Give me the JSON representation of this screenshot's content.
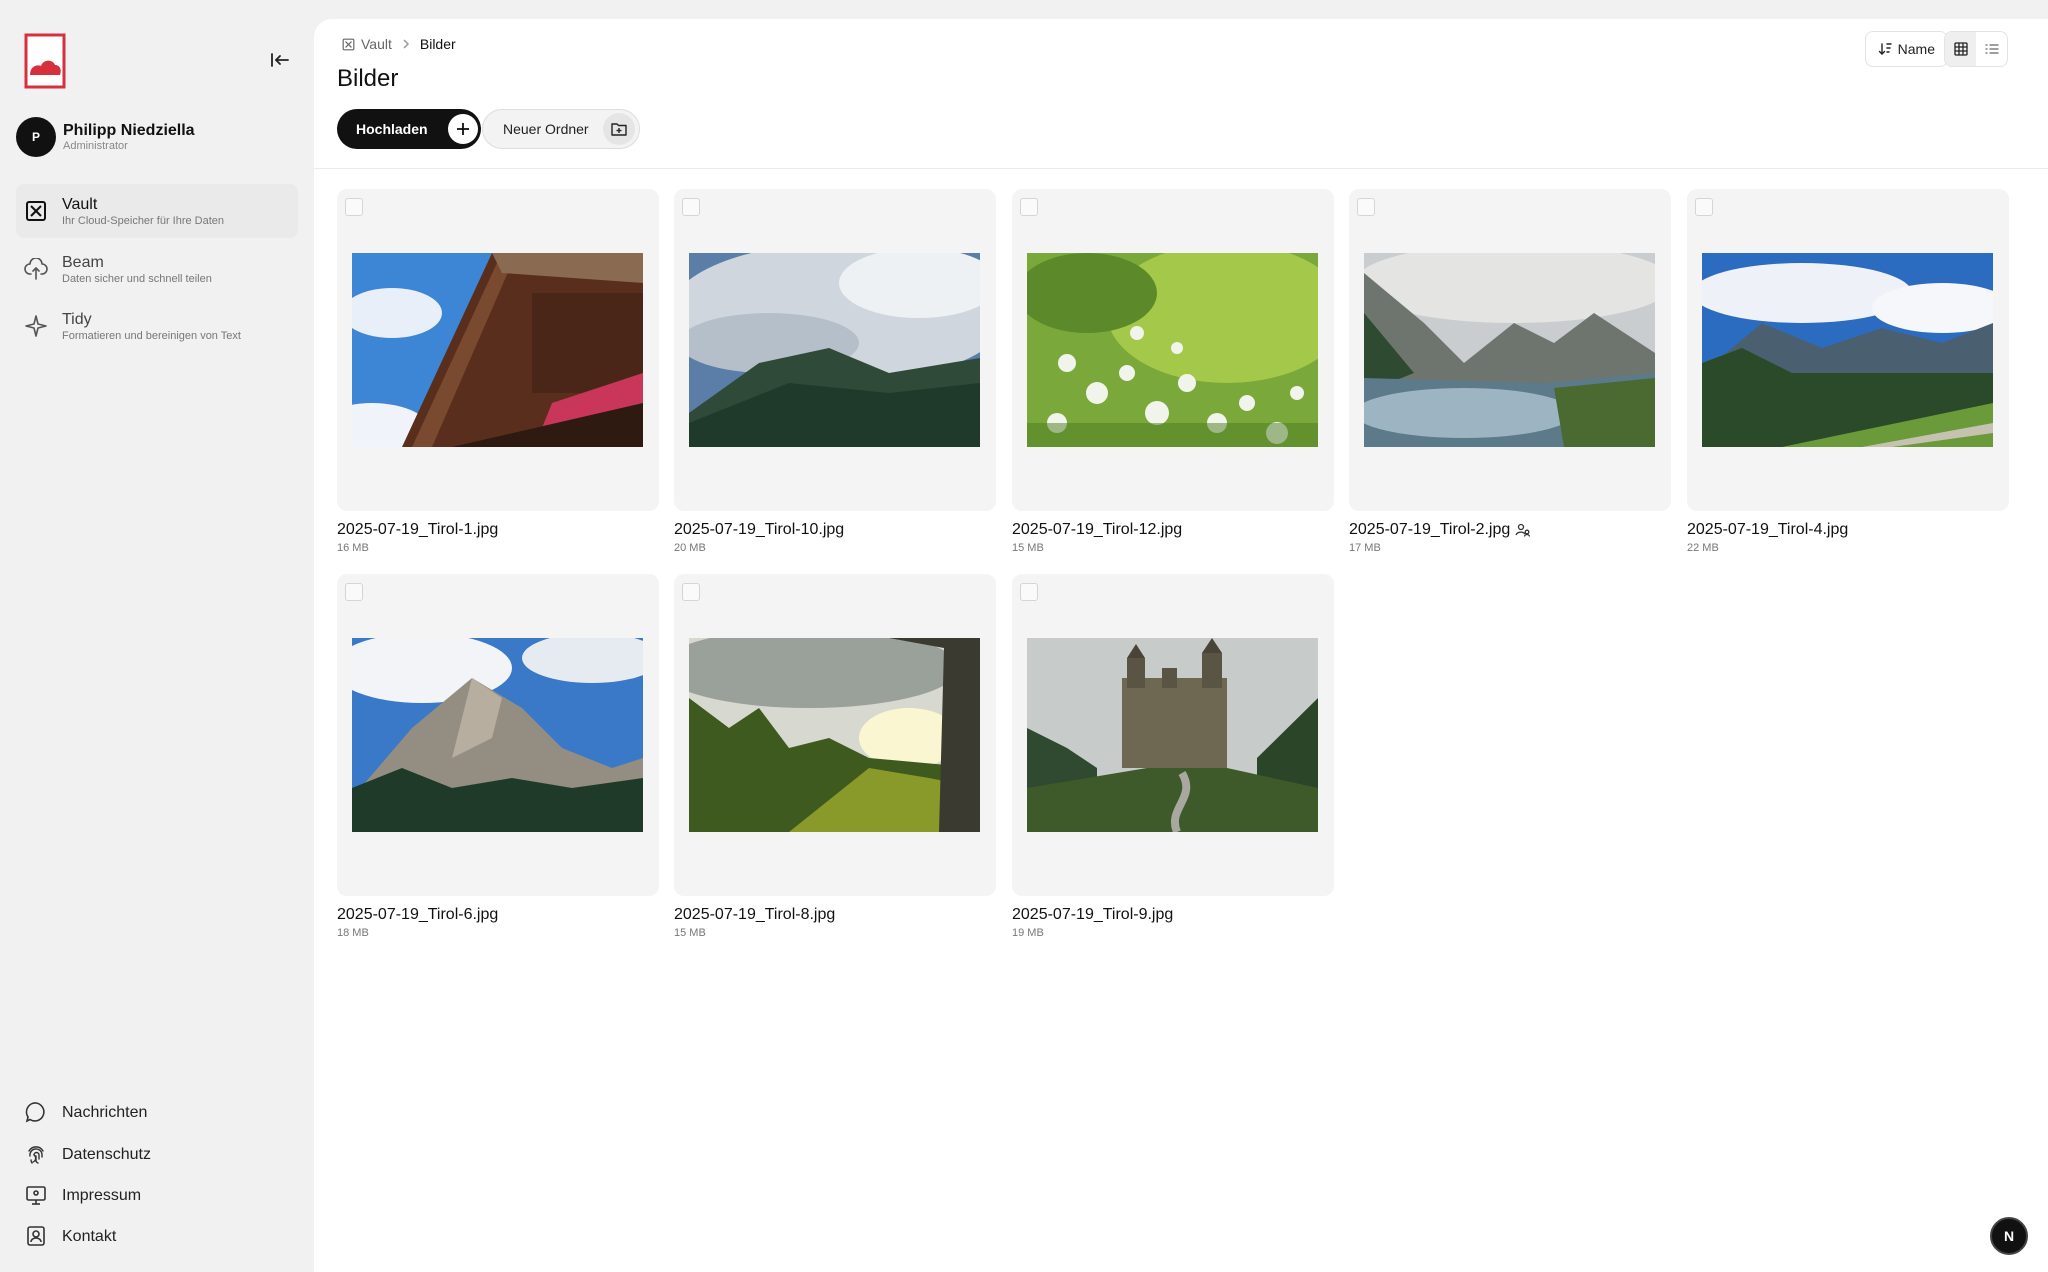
{
  "sidebar": {
    "user": {
      "initial": "P",
      "name": "Philipp Niedziella",
      "role": "Administrator"
    },
    "nav": [
      {
        "title": "Vault",
        "subtitle": "Ihr Cloud-Speicher für Ihre Daten",
        "icon": "vault-icon",
        "active": true
      },
      {
        "title": "Beam",
        "subtitle": "Daten sicher und schnell teilen",
        "icon": "cloud-upload-icon",
        "active": false
      },
      {
        "title": "Tidy",
        "subtitle": "Formatieren und bereinigen von Text",
        "icon": "sparkle-icon",
        "active": false
      }
    ],
    "footer": [
      {
        "label": "Nachrichten",
        "icon": "chat-bubble-icon"
      },
      {
        "label": "Datenschutz",
        "icon": "fingerprint-icon"
      },
      {
        "label": "Impressum",
        "icon": "monitor-icon"
      },
      {
        "label": "Kontakt",
        "icon": "contact-card-icon"
      }
    ]
  },
  "breadcrumb": {
    "root": "Vault",
    "current": "Bilder"
  },
  "page": {
    "title": "Bilder"
  },
  "actions": {
    "upload": "Hochladen",
    "new_folder": "Neuer Ordner"
  },
  "toolbar": {
    "sort_label": "Name",
    "view_mode": "grid"
  },
  "files": [
    {
      "name": "2025-07-19_Tirol-1.jpg",
      "size": "16 MB",
      "shared": false
    },
    {
      "name": "2025-07-19_Tirol-10.jpg",
      "size": "20 MB",
      "shared": false
    },
    {
      "name": "2025-07-19_Tirol-12.jpg",
      "size": "15 MB",
      "shared": false
    },
    {
      "name": "2025-07-19_Tirol-2.jpg",
      "size": "17 MB",
      "shared": true
    },
    {
      "name": "2025-07-19_Tirol-4.jpg",
      "size": "22 MB",
      "shared": false
    },
    {
      "name": "2025-07-19_Tirol-6.jpg",
      "size": "18 MB",
      "shared": false
    },
    {
      "name": "2025-07-19_Tirol-8.jpg",
      "size": "15 MB",
      "shared": false
    },
    {
      "name": "2025-07-19_Tirol-9.jpg",
      "size": "19 MB",
      "shared": false
    }
  ],
  "badge": {
    "letter": "N"
  },
  "colors": {
    "brand": "#d6303c",
    "accent": "#111111"
  }
}
